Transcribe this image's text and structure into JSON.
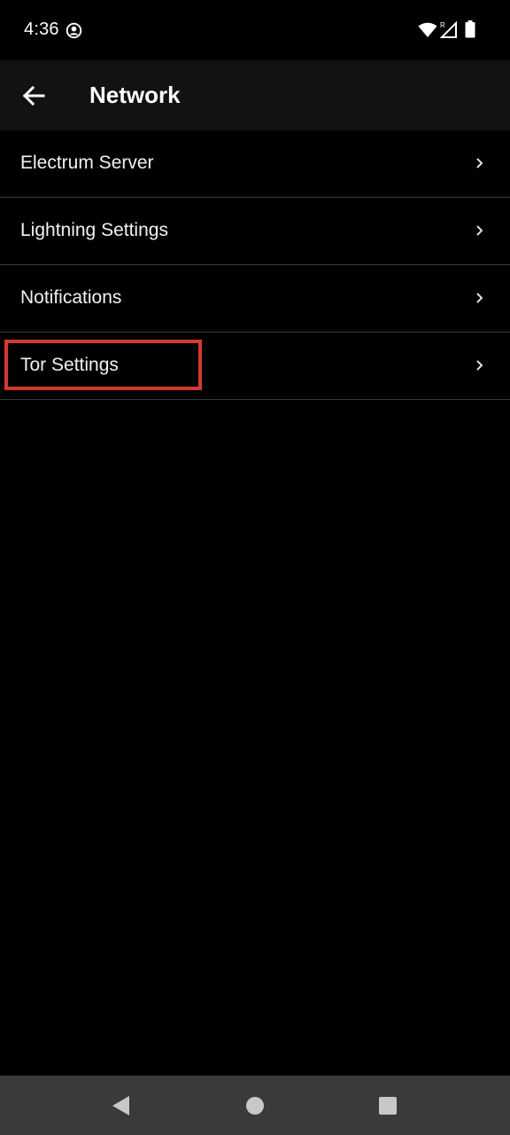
{
  "status_bar": {
    "time": "4:36",
    "icons": [
      "account-circle-icon",
      "wifi-icon",
      "signal-roaming-icon",
      "battery-icon"
    ]
  },
  "app_bar": {
    "title": "Network",
    "back_icon": "arrow-back-icon"
  },
  "settings": {
    "items": [
      {
        "label": "Electrum Server",
        "icon": "chevron-right-icon"
      },
      {
        "label": "Lightning Settings",
        "icon": "chevron-right-icon"
      },
      {
        "label": "Notifications",
        "icon": "chevron-right-icon"
      },
      {
        "label": "Tor Settings",
        "icon": "chevron-right-icon",
        "highlighted": true
      }
    ]
  },
  "nav_bar": {
    "icons": [
      "nav-back-triangle-icon",
      "nav-home-circle-icon",
      "nav-recents-square-icon"
    ]
  },
  "colors": {
    "background": "#000000",
    "app_bar": "#121212",
    "divider": "#3a3a3a",
    "highlight": "#d23a2f",
    "nav_bar": "#3a3a3a",
    "nav_icon": "#c8c8c8"
  }
}
